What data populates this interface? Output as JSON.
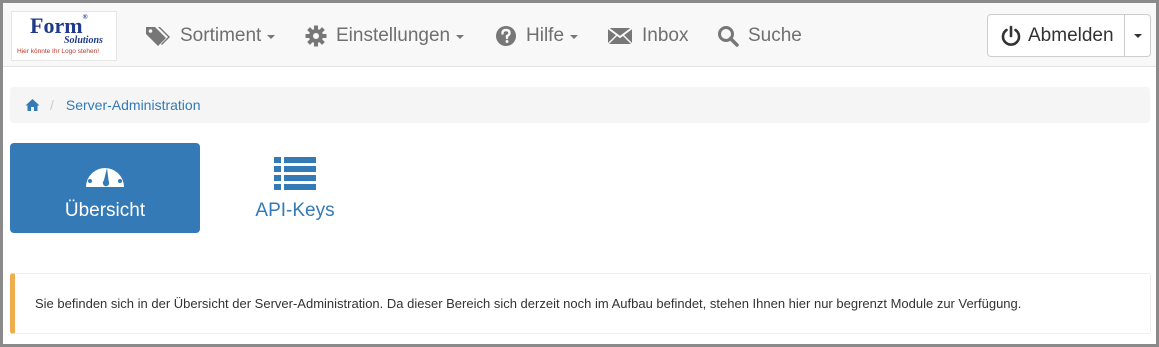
{
  "logo": {
    "brand": "Form",
    "registered": "®",
    "sub": "Solutions",
    "tagline": "Hier könnte Ihr Logo stehen!"
  },
  "nav": {
    "items": [
      {
        "label": "Sortiment",
        "icon": "tags-icon",
        "dropdown": true
      },
      {
        "label": "Einstellungen",
        "icon": "gear-icon",
        "dropdown": true
      },
      {
        "label": "Hilfe",
        "icon": "question-circle-icon",
        "dropdown": true
      },
      {
        "label": "Inbox",
        "icon": "envelope-icon",
        "dropdown": false
      },
      {
        "label": "Suche",
        "icon": "search-icon",
        "dropdown": false
      }
    ],
    "logout_label": "Abmelden"
  },
  "breadcrumb": {
    "home_icon": "home-icon",
    "items": [
      "Server-Administration"
    ]
  },
  "tiles": [
    {
      "label": "Übersicht",
      "icon": "dashboard-icon",
      "active": true
    },
    {
      "label": "API-Keys",
      "icon": "list-icon",
      "active": false
    }
  ],
  "alert": {
    "text": "Sie befinden sich in der Übersicht der Server-Administration. Da dieser Bereich sich derzeit noch im Aufbau befindet, stehen Ihnen hier nur begrenzt Module zur Verfügung."
  },
  "colors": {
    "primary": "#337ab7",
    "alert_border": "#f0ad4e",
    "nav_text": "#6f6f6f",
    "navbar_bg": "#f8f8f8"
  }
}
